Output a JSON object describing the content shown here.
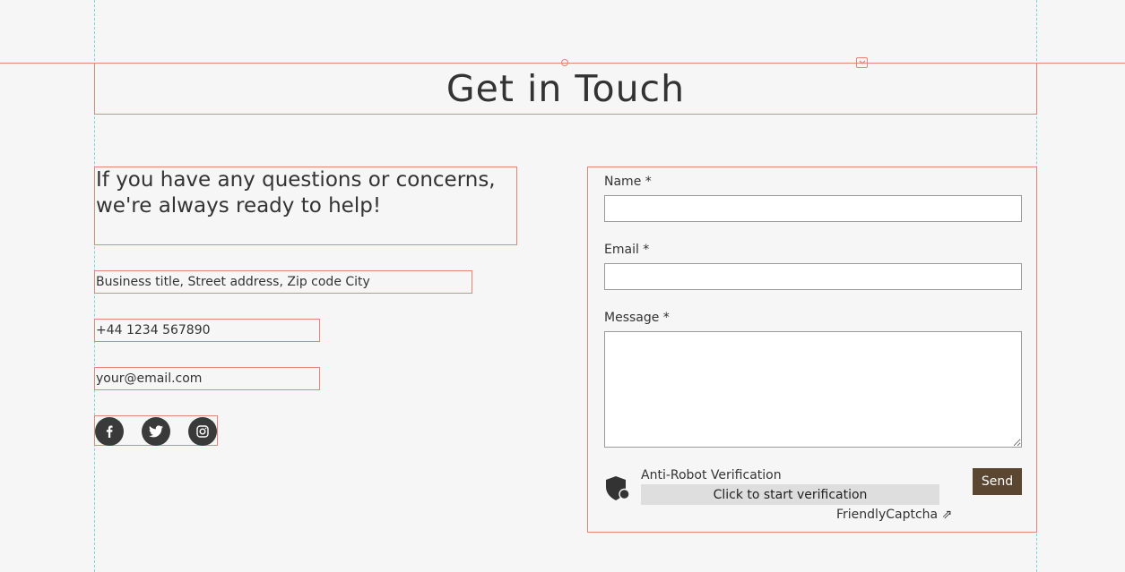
{
  "page": {
    "title": "Get in Touch"
  },
  "contact": {
    "intro": "If you have any questions or concerns, we're always ready to help!",
    "address": "Business title, Street address, Zip code City",
    "phone": "+44 1234 567890",
    "email": "your@email.com"
  },
  "social": [
    {
      "icon": "facebook-icon"
    },
    {
      "icon": "twitter-icon"
    },
    {
      "icon": "instagram-icon"
    }
  ],
  "form": {
    "name_label": "Name *",
    "name_value": "",
    "email_label": "Email *",
    "email_value": "",
    "message_label": "Message *",
    "message_value": "",
    "send_label": "Send"
  },
  "captcha": {
    "title": "Anti-Robot Verification",
    "button_label": "Click to start verification",
    "provider_link": "FriendlyCaptcha ⇗"
  },
  "colors": {
    "background": "#f6f6f6",
    "selection_outline": "#e2867a",
    "guide_line": "#7fd3dc",
    "send_button": "#5a4631",
    "social_button": "#3a3a3a"
  }
}
